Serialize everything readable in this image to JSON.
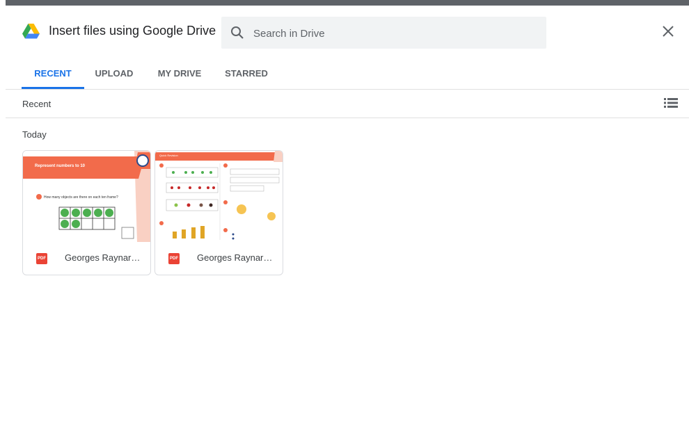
{
  "dialog": {
    "title": "Insert files using Google Drive",
    "search": {
      "placeholder": "Search in Drive",
      "value": ""
    },
    "tabs": [
      {
        "label": "RECENT",
        "active": true
      },
      {
        "label": "UPLOAD",
        "active": false
      },
      {
        "label": "MY DRIVE",
        "active": false
      },
      {
        "label": "STARRED",
        "active": false
      }
    ],
    "subbar": {
      "label": "Recent",
      "view_icon": "list-view-icon"
    },
    "section": "Today",
    "files": [
      {
        "name": "Georges Raynard...",
        "type_badge": "PDF",
        "thumb_title": "Represent numbers to 10",
        "thumb_question": "How many objects are there on each ten frame?"
      },
      {
        "name": "Georges Raynard...",
        "type_badge": "PDF",
        "thumb_title": "Quick Revision",
        "thumb_question": ""
      }
    ]
  },
  "colors": {
    "accent": "#1a73e8",
    "pdf_red": "#ea4335",
    "thumb_orange": "#f26b4b"
  },
  "icons": [
    "google-drive-icon",
    "search-icon",
    "close-icon",
    "list-view-icon",
    "pdf-icon"
  ]
}
